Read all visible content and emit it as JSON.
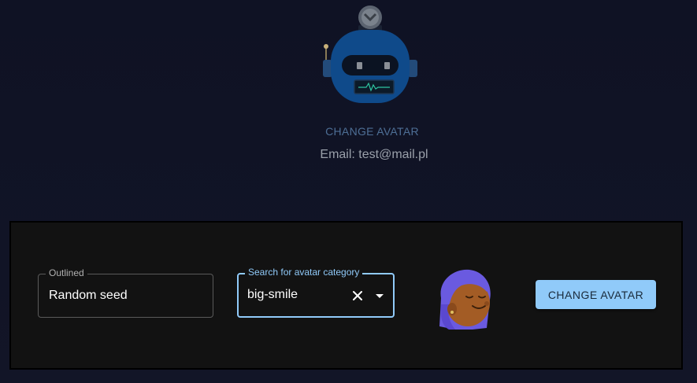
{
  "profile": {
    "avatar_icon": "robot-avatar",
    "change_link_label": "CHANGE AVATAR",
    "email_text": "Email: test@mail.pl"
  },
  "form": {
    "seed_field": {
      "label": "Outlined",
      "value": "Random seed"
    },
    "category_field": {
      "label": "Search for avatar category",
      "value": "big-smile",
      "clear_icon": "close-icon",
      "dropdown_icon": "arrow-drop-down-icon"
    },
    "preview_icon": "big-smile-avatar",
    "change_button_label": "CHANGE AVATAR"
  },
  "colors": {
    "accent": "#90caf9",
    "link": "#4e6f96",
    "panel_bg": "#121212",
    "page_bg": "#111426"
  }
}
